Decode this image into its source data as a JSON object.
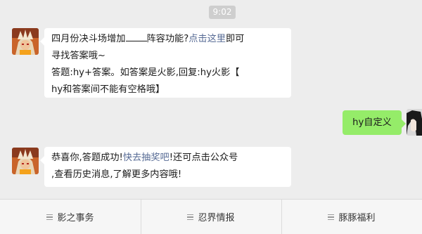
{
  "chat": {
    "timestamp": "9:02",
    "message1": {
      "line1_prefix": "四月份决斗场增加",
      "line1_suffix": "阵容功能?",
      "link_text": "点击这里",
      "line1_after_link": "即可",
      "line2": "寻找答案哦~",
      "line3": "答题:hy+答案。如答案是火影,回复:hy火影【",
      "line4": "hy和答案间不能有空格哦】"
    },
    "message2": {
      "text": "hy自定义"
    },
    "message3": {
      "line1_prefix": "恭喜你,答题成功!",
      "link_text": "快去抽奖吧",
      "line1_suffix": "!还可点击公众号",
      "line2": ",查看历史消息,了解更多内容哦!"
    }
  },
  "menu": {
    "items": [
      {
        "label": "影之事务"
      },
      {
        "label": "忍界情报"
      },
      {
        "label": "豚豚福利"
      }
    ]
  },
  "colors": {
    "background": "#ededed",
    "incoming_bubble": "#ffffff",
    "outgoing_bubble": "#95ec69",
    "link": "#576b95"
  },
  "icons": {
    "bot_avatar": "naruto-sage-avatar",
    "user_avatar": "dark-hair-avatar",
    "menu": "menu-lines-icon"
  }
}
